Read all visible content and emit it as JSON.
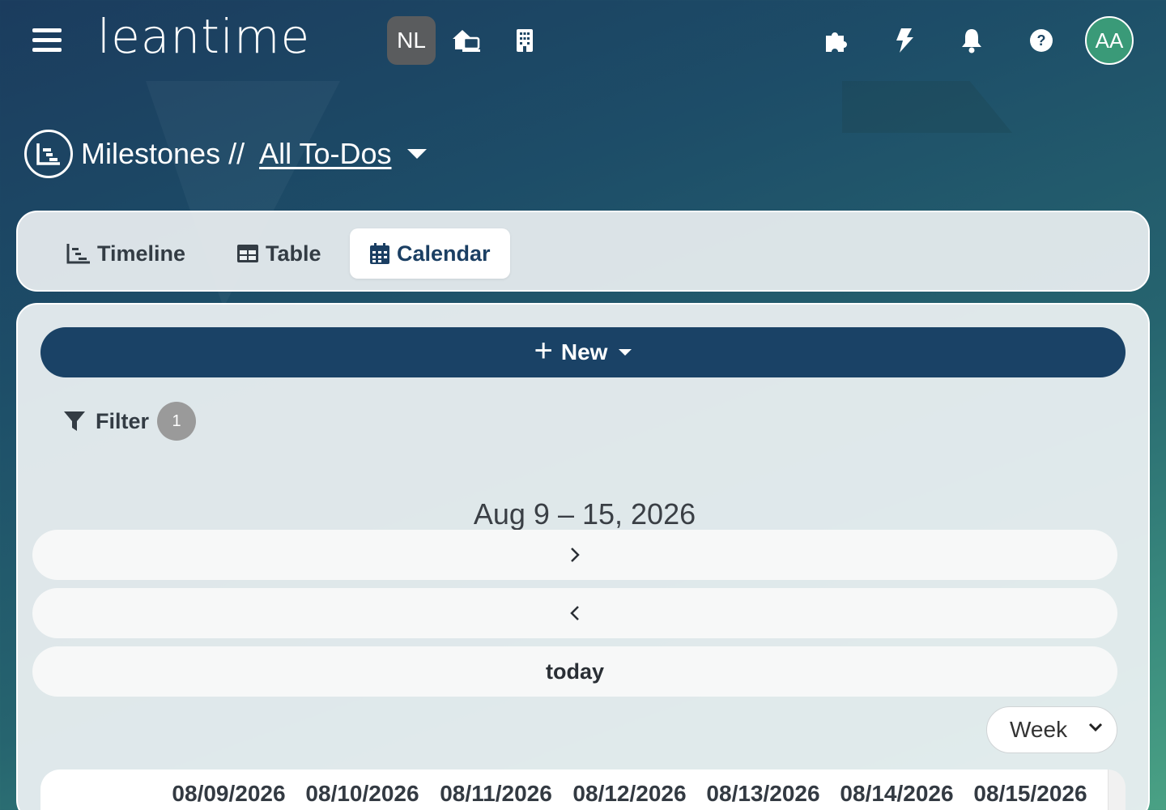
{
  "header": {
    "logo": "leantime",
    "project_initials": "NL",
    "user_initials": "AA",
    "icons": [
      "menu-icon",
      "project-hub-icon",
      "company-icon",
      "apps-icon",
      "bolt-icon",
      "bell-icon",
      "help-icon"
    ]
  },
  "page": {
    "section": "Milestones //",
    "view_name": "All To-Dos "
  },
  "tabs": [
    {
      "label": "Timeline",
      "icon": "timeline-icon"
    },
    {
      "label": "Table",
      "icon": "table-icon"
    },
    {
      "label": "Calendar",
      "icon": "calendar-icon",
      "active": true
    }
  ],
  "toolbar": {
    "new_label": "New",
    "filter_label": "Filter",
    "filter_count": "1"
  },
  "calendar": {
    "range_title": "Aug 9 – 15, 2026",
    "next_label": ">",
    "prev_label": "<",
    "today_label": "today",
    "view_selected": "Week",
    "dates": [
      "08/09/2026",
      "08/10/2026",
      "08/11/2026",
      "08/12/2026",
      "08/13/2026",
      "08/14/2026",
      "08/15/2026"
    ]
  },
  "colors": {
    "primary": "#1a4266",
    "avatar": "#3a9a78",
    "badge": "#5a5c5e"
  }
}
